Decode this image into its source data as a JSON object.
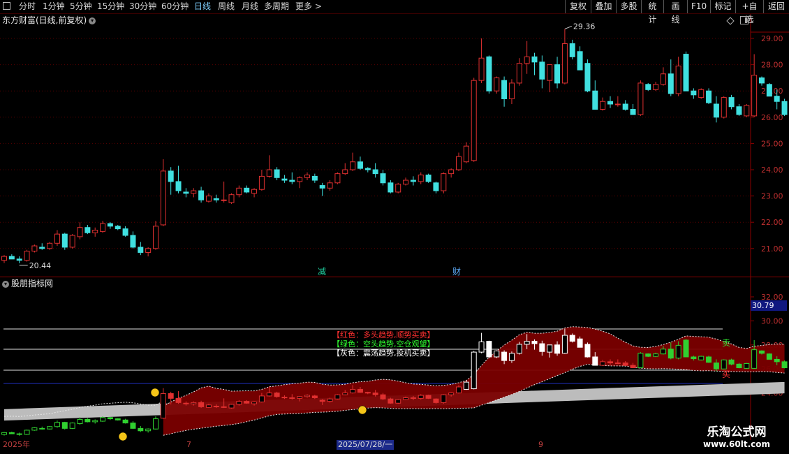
{
  "toolbar": {
    "left_items": [
      "分时",
      "1分钟",
      "5分钟",
      "15分钟",
      "30分钟",
      "60分钟",
      "日线",
      "周线",
      "月线",
      "多周期",
      "更多 >"
    ],
    "active": "日线",
    "right_items": [
      "复权",
      "叠加",
      "多股",
      "统计",
      "画线",
      "F10",
      "标记",
      "+自选",
      "返回"
    ]
  },
  "main_chart": {
    "title": "东方财富(日线,前复权)",
    "price_ticks": [
      "29.00",
      "28.00",
      "27.00",
      "26.00",
      "25.00",
      "24.00",
      "23.00",
      "22.00",
      "21.00"
    ],
    "high_label": "29.36",
    "low_label": "20.44",
    "markers": [
      "减",
      "财"
    ],
    "colors": {
      "up": "#e03030",
      "down": "#40e0e0",
      "background": "#000000"
    }
  },
  "indicator": {
    "title": "股朋指标网",
    "value_ticks": [
      "32.00",
      "30.00",
      "28.00",
      "26.00",
      "24.00"
    ],
    "current_value": "30.79",
    "legend": [
      {
        "text": "【红色：多头趋势,顺势买卖】",
        "color": "#ff3030"
      },
      {
        "text": "【绿色：空头趋势,空仓观望】",
        "color": "#30ff30"
      },
      {
        "text": "【灰色：震荡趋势,投机买卖】",
        "color": "#ffffff"
      }
    ],
    "sell_label": "卖",
    "buy_label": "买"
  },
  "dates": {
    "labels": [
      "2025年",
      "7",
      "9"
    ],
    "selected": "2025/07/28/一"
  },
  "watermark": {
    "line1": "乐淘公式网",
    "line2": "www.60lt.com"
  },
  "chart_data": {
    "type": "candlestick",
    "title": "东方财富(日线,前复权)",
    "ylim": [
      20.0,
      29.6
    ],
    "candles": [
      [
        20.55,
        20.75,
        20.45,
        20.7
      ],
      [
        20.7,
        20.78,
        20.6,
        20.6
      ],
      [
        20.6,
        20.7,
        20.44,
        20.55
      ],
      [
        20.55,
        20.95,
        20.5,
        20.9
      ],
      [
        20.9,
        21.15,
        20.85,
        21.1
      ],
      [
        21.05,
        21.2,
        20.95,
        21.0
      ],
      [
        21.0,
        21.25,
        20.95,
        21.2
      ],
      [
        21.2,
        21.7,
        21.1,
        21.55
      ],
      [
        21.55,
        21.6,
        20.95,
        21.05
      ],
      [
        21.05,
        21.55,
        21.0,
        21.5
      ],
      [
        21.45,
        22.0,
        21.35,
        21.8
      ],
      [
        21.8,
        21.9,
        21.55,
        21.6
      ],
      [
        21.6,
        21.8,
        21.45,
        21.7
      ],
      [
        21.65,
        22.05,
        21.6,
        21.95
      ],
      [
        21.95,
        22.0,
        21.75,
        21.85
      ],
      [
        21.85,
        21.9,
        21.7,
        21.75
      ],
      [
        21.75,
        21.85,
        21.45,
        21.5
      ],
      [
        21.5,
        21.65,
        21.0,
        21.05
      ],
      [
        21.05,
        21.25,
        20.75,
        20.85
      ],
      [
        20.85,
        21.05,
        20.7,
        21.0
      ],
      [
        21.0,
        22.05,
        20.95,
        21.85
      ],
      [
        21.9,
        24.4,
        21.85,
        23.95
      ],
      [
        23.95,
        24.1,
        23.05,
        23.55
      ],
      [
        23.55,
        24.15,
        23.1,
        23.2
      ],
      [
        23.15,
        23.3,
        22.95,
        23.1
      ],
      [
        23.1,
        23.3,
        22.95,
        23.2
      ],
      [
        23.2,
        23.35,
        22.75,
        22.85
      ],
      [
        22.8,
        23.1,
        22.75,
        23.0
      ],
      [
        22.9,
        23.05,
        22.75,
        22.85
      ],
      [
        22.85,
        23.55,
        22.75,
        22.85
      ],
      [
        22.75,
        23.1,
        22.7,
        23.05
      ],
      [
        23.05,
        23.4,
        22.95,
        23.3
      ],
      [
        23.3,
        23.4,
        23.1,
        23.15
      ],
      [
        23.1,
        23.3,
        22.95,
        23.25
      ],
      [
        23.25,
        24.0,
        23.2,
        23.75
      ],
      [
        23.75,
        24.55,
        23.7,
        24.0
      ],
      [
        24.0,
        24.1,
        23.6,
        23.7
      ],
      [
        23.65,
        23.8,
        23.5,
        23.6
      ],
      [
        23.6,
        23.9,
        23.45,
        23.55
      ],
      [
        23.55,
        23.75,
        23.3,
        23.7
      ],
      [
        23.7,
        23.9,
        23.6,
        23.8
      ],
      [
        23.75,
        23.85,
        23.5,
        23.6
      ],
      [
        23.4,
        23.5,
        23.0,
        23.3
      ],
      [
        23.3,
        23.6,
        23.2,
        23.5
      ],
      [
        23.5,
        23.9,
        23.45,
        23.85
      ],
      [
        23.85,
        24.25,
        23.8,
        24.0
      ],
      [
        24.0,
        24.65,
        23.95,
        24.3
      ],
      [
        24.3,
        24.5,
        24.0,
        24.05
      ],
      [
        24.05,
        24.1,
        23.9,
        24.0
      ],
      [
        24.0,
        24.25,
        23.7,
        23.85
      ],
      [
        23.85,
        24.0,
        23.4,
        23.5
      ],
      [
        23.5,
        23.6,
        23.1,
        23.15
      ],
      [
        23.15,
        23.5,
        23.1,
        23.45
      ],
      [
        23.45,
        23.7,
        23.4,
        23.6
      ],
      [
        23.6,
        23.75,
        23.4,
        23.55
      ],
      [
        23.55,
        23.9,
        23.45,
        23.8
      ],
      [
        23.8,
        23.85,
        23.5,
        23.55
      ],
      [
        23.5,
        23.55,
        23.1,
        23.2
      ],
      [
        23.2,
        23.9,
        23.1,
        23.85
      ],
      [
        23.85,
        24.05,
        23.7,
        24.0
      ],
      [
        24.0,
        24.65,
        23.95,
        24.5
      ],
      [
        24.3,
        25.05,
        24.25,
        24.9
      ],
      [
        24.35,
        27.5,
        24.3,
        27.4
      ],
      [
        27.4,
        29.0,
        27.3,
        28.25
      ],
      [
        28.3,
        28.35,
        26.9,
        27.0
      ],
      [
        27.0,
        27.55,
        26.9,
        27.5
      ],
      [
        27.4,
        27.55,
        26.4,
        26.7
      ],
      [
        26.7,
        27.45,
        26.5,
        27.3
      ],
      [
        27.3,
        28.25,
        27.2,
        28.05
      ],
      [
        28.05,
        28.9,
        27.65,
        28.3
      ],
      [
        28.3,
        28.45,
        27.6,
        28.1
      ],
      [
        28.1,
        28.35,
        27.1,
        27.45
      ],
      [
        27.4,
        28.0,
        26.95,
        28.0
      ],
      [
        28.0,
        28.3,
        27.1,
        27.3
      ],
      [
        27.3,
        29.36,
        27.25,
        28.8
      ],
      [
        28.8,
        28.95,
        28.2,
        28.3
      ],
      [
        28.5,
        28.7,
        27.85,
        27.8
      ],
      [
        28.05,
        28.2,
        26.95,
        27.0
      ],
      [
        27.0,
        27.4,
        26.45,
        26.3
      ],
      [
        26.3,
        26.75,
        26.25,
        26.6
      ],
      [
        26.6,
        26.8,
        26.35,
        26.5
      ],
      [
        26.5,
        26.8,
        26.4,
        26.5
      ],
      [
        26.5,
        26.65,
        26.25,
        26.3
      ],
      [
        26.3,
        26.5,
        26.1,
        26.1
      ],
      [
        26.1,
        27.4,
        26.05,
        27.3
      ],
      [
        27.25,
        27.3,
        27.0,
        27.05
      ],
      [
        27.05,
        27.35,
        27.0,
        27.25
      ],
      [
        27.25,
        27.9,
        27.2,
        27.65
      ],
      [
        27.65,
        28.2,
        26.8,
        26.9
      ],
      [
        26.9,
        28.3,
        26.8,
        27.95
      ],
      [
        28.4,
        28.5,
        27.65,
        27.0
      ],
      [
        27.0,
        27.1,
        26.7,
        26.85
      ],
      [
        26.75,
        27.1,
        26.7,
        27.05
      ],
      [
        27.0,
        27.1,
        26.5,
        26.55
      ],
      [
        26.5,
        26.8,
        25.8,
        26.0
      ],
      [
        26.0,
        26.8,
        25.95,
        26.75
      ],
      [
        26.75,
        26.85,
        26.3,
        26.4
      ],
      [
        26.4,
        26.5,
        26.05,
        26.1
      ],
      [
        26.05,
        26.5,
        26.0,
        26.45
      ],
      [
        26.05,
        28.4,
        26.0,
        27.6
      ],
      [
        27.5,
        27.55,
        27.2,
        27.3
      ],
      [
        27.25,
        27.3,
        26.85,
        26.8
      ],
      [
        26.8,
        27.05,
        26.3,
        26.6
      ],
      [
        26.6,
        26.7,
        26.05,
        26.1
      ]
    ]
  }
}
